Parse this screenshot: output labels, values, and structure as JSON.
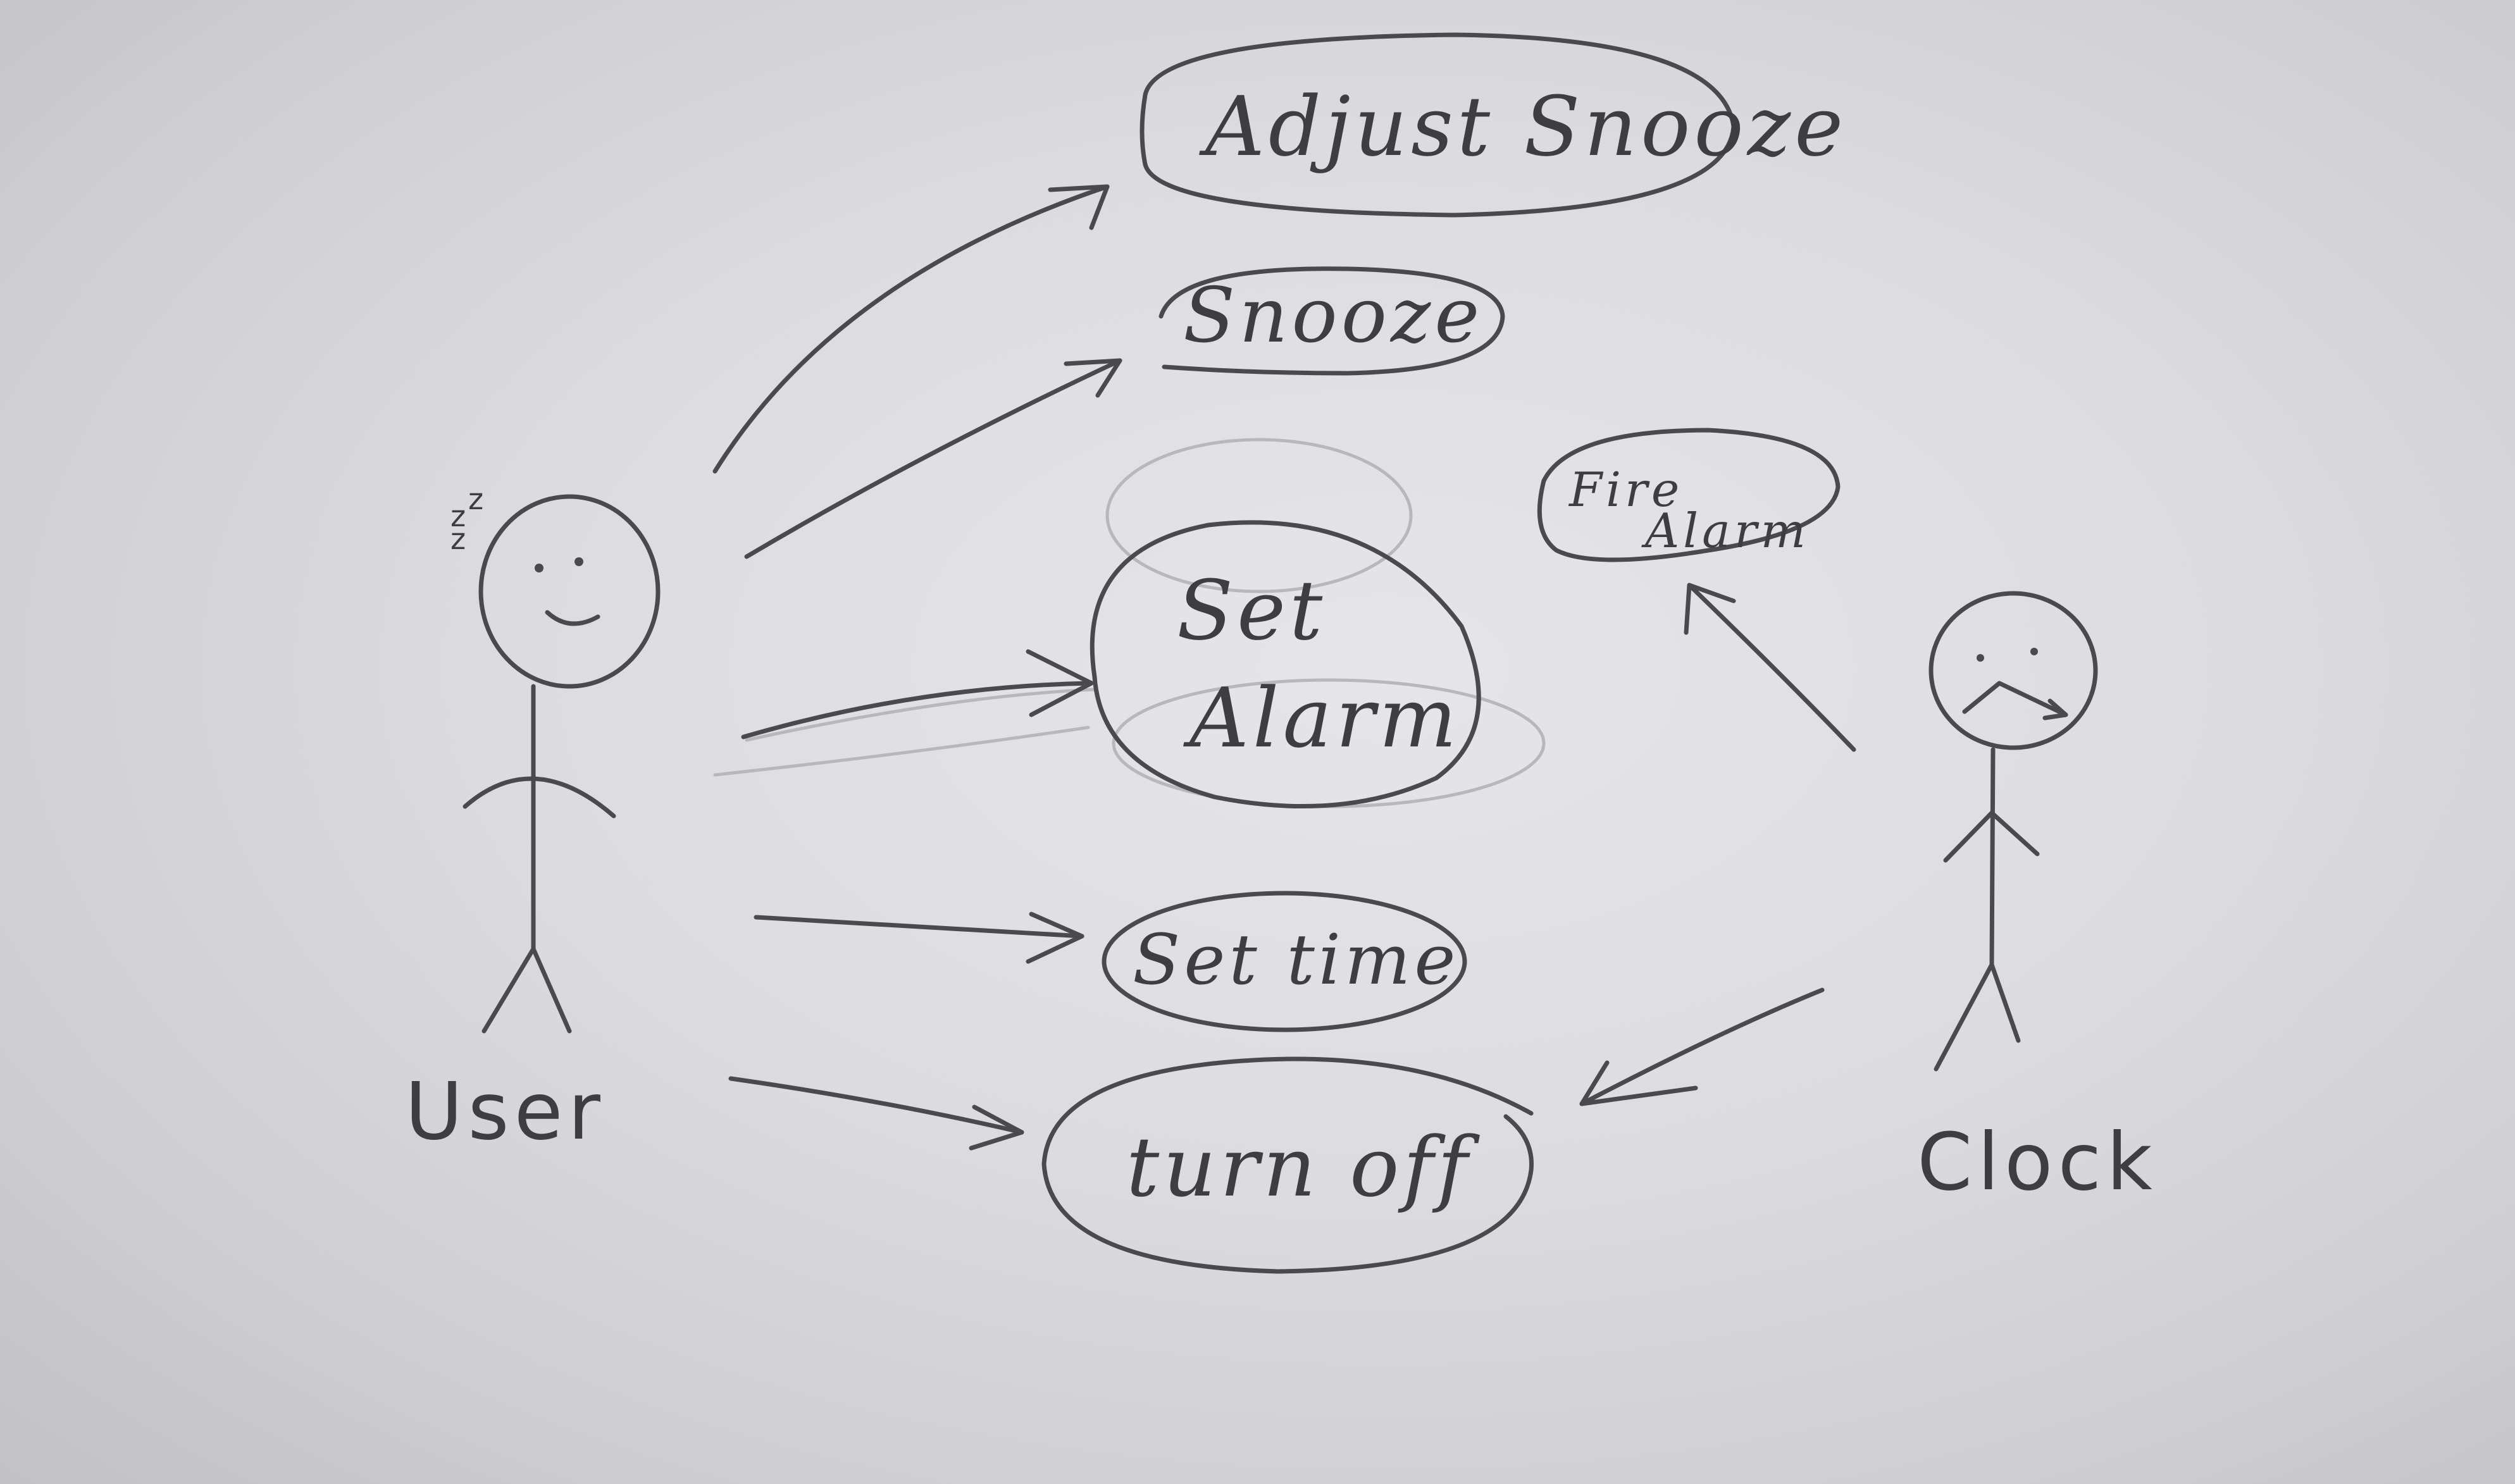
{
  "actors": {
    "user": {
      "label": "User"
    },
    "clock": {
      "label": "Clock"
    }
  },
  "use_cases": {
    "adjust_snooze": "Adjust Snooze",
    "snooze": "Snooze",
    "set_alarm_line1": "Set",
    "set_alarm_line2": "Alarm",
    "set_time": "Set time",
    "turn_off": "turn off",
    "fire_alarm_line1": "Fire",
    "fire_alarm_line2": "Alarm"
  },
  "decorations": {
    "sleep_z_1": "z",
    "sleep_z_2": "z",
    "sleep_z_3": "z"
  },
  "colors": {
    "ink": "#4a4a4e",
    "paper": "#dcdcde"
  }
}
